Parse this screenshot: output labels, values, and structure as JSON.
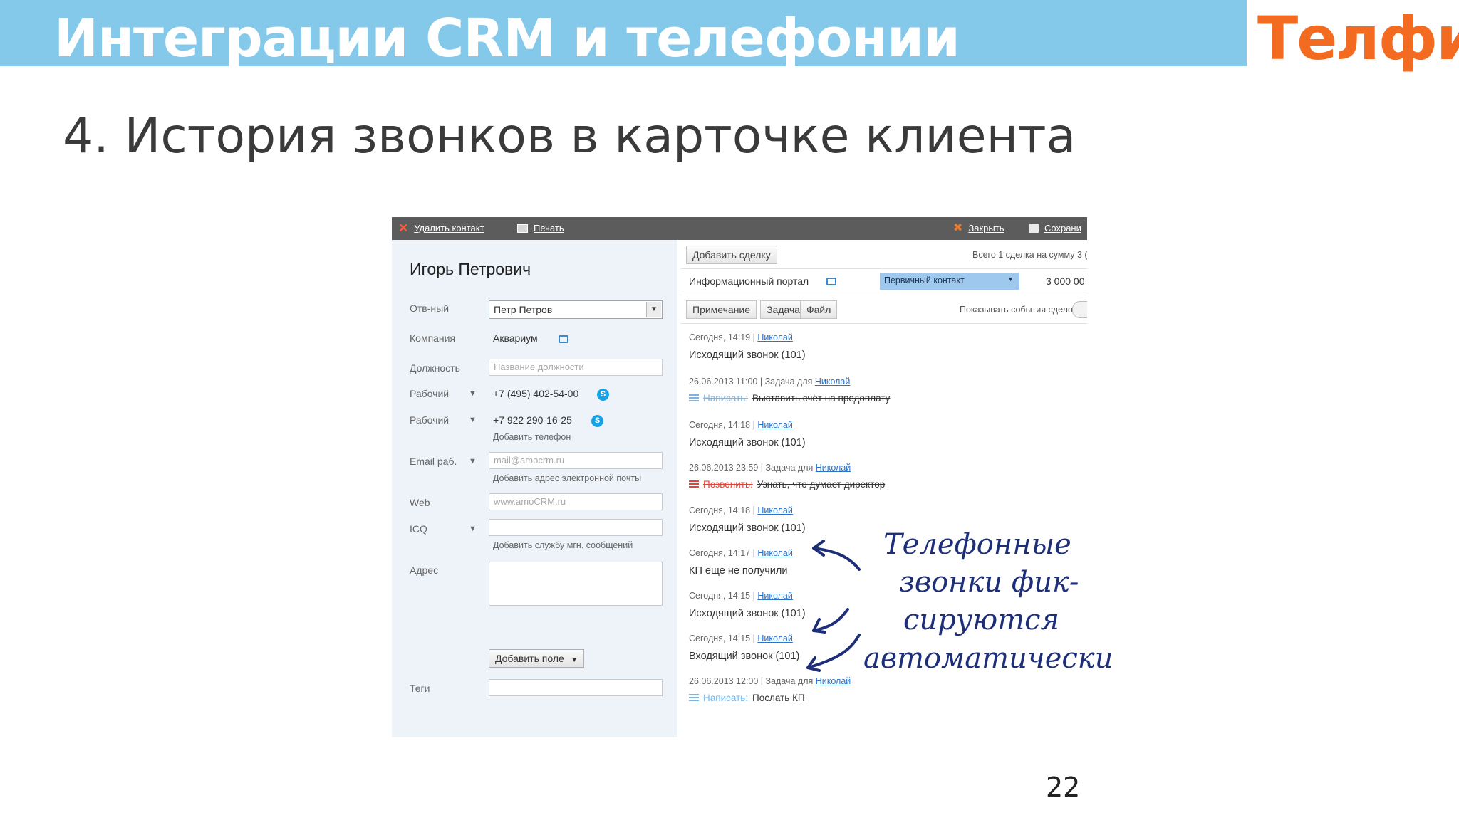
{
  "slide": {
    "title": "Интеграции CRM и телефонии",
    "logo": "Телфин",
    "subtitle": "4. История звонков в карточке клиента",
    "page_number": "22",
    "annotation_lines": [
      "Телефонные",
      "звонки фик-",
      "сируются",
      "автоматически"
    ]
  },
  "toolbar": {
    "delete_label": "Удалить контакт",
    "print_label": "Печать",
    "close_label": "Закрыть",
    "save_label": "Сохрани"
  },
  "contact": {
    "name": "Игорь Петрович",
    "fields": {
      "responsible_label": "Отв-ный",
      "responsible_value": "Петр Петров",
      "company_label": "Компания",
      "company_value": "Аквариум",
      "position_label": "Должность",
      "position_placeholder": "Название должности",
      "work1_label": "Рабочий",
      "work1_value": "+7 (495) 402-54-00",
      "work2_label": "Рабочий",
      "work2_value": "+7 922 290-16-25",
      "add_phone": "Добавить телефон",
      "email_label": "Email раб.",
      "email_placeholder": "mail@amocrm.ru",
      "add_email": "Добавить адрес электронной почты",
      "web_label": "Web",
      "web_placeholder": "www.amoCRM.ru",
      "icq_label": "ICQ",
      "add_im": "Добавить службу мгн. сообщений",
      "address_label": "Адрес",
      "add_field": "Добавить поле",
      "tags_label": "Теги"
    }
  },
  "deals": {
    "add_deal": "Добавить сделку",
    "summary": "Всего 1 сделка на сумму 3 (",
    "deal_name": "Информационный портал",
    "deal_status": "Первичный контакт",
    "deal_amount": "3 000 00"
  },
  "tabs": {
    "note": "Примечание",
    "task": "Задача",
    "file": "Файл",
    "show_events": "Показывать события сделок"
  },
  "events": [
    {
      "meta": "Сегодня, 14:19 | ",
      "user": "Николай",
      "text": "Исходящий звонок (101)"
    },
    {
      "meta": "26.06.2013 11:00 | Задача для ",
      "user": "Николай",
      "verb": "Написать:",
      "body": "Выставить счёт на предоплату"
    },
    {
      "meta": "Сегодня, 14:18 | ",
      "user": "Николай",
      "text": "Исходящий звонок (101)"
    },
    {
      "meta": "26.06.2013 23:59 | Задача для ",
      "user": "Николай",
      "verb": "Позвонить:",
      "body": "Узнать, что думает директор"
    },
    {
      "meta": "Сегодня, 14:18 | ",
      "user": "Николай",
      "text": "Исходящий звонок (101)"
    },
    {
      "meta": "Сегодня, 14:17 | ",
      "user": "Николай",
      "text": "КП еще не получили"
    },
    {
      "meta": "Сегодня, 14:15 | ",
      "user": "Николай",
      "text": "Исходящий звонок (101)"
    },
    {
      "meta": "Сегодня, 14:15 | ",
      "user": "Николай",
      "text": "Входящий звонок (101)"
    },
    {
      "meta": "26.06.2013 12:00 | Задача для ",
      "user": "Николай",
      "verb": "Написать:",
      "body": "Послать КП"
    }
  ]
}
